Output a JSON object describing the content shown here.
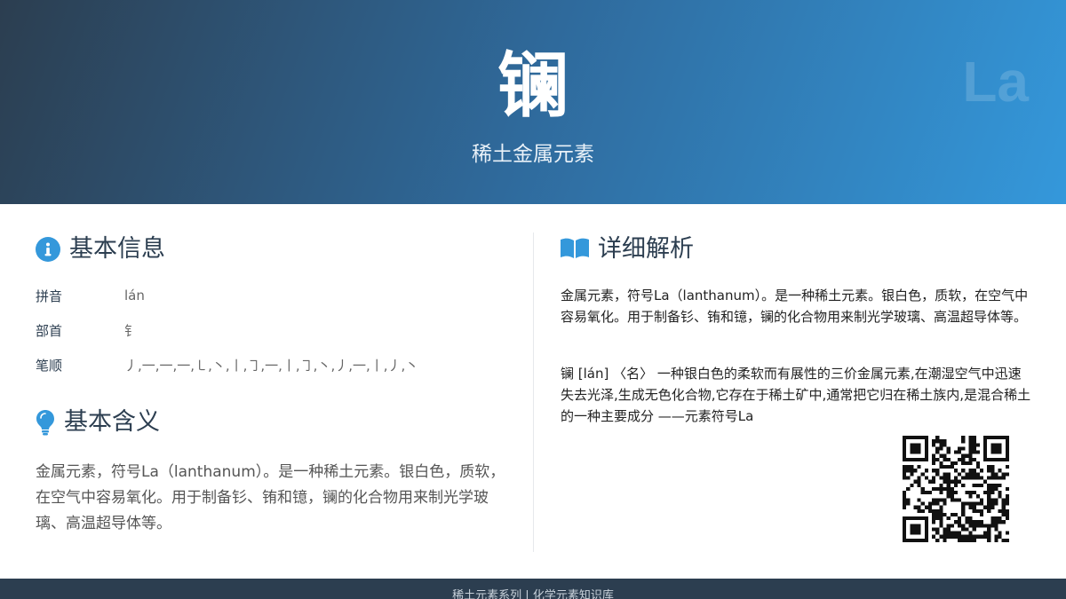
{
  "header": {
    "character": "镧",
    "subtitle": "稀土金属元素",
    "symbol": "La"
  },
  "basic_info": {
    "title": "基本信息",
    "icon": "info-circle-icon",
    "rows": [
      {
        "label": "拼音",
        "value": "lán"
      },
      {
        "label": "部首",
        "value": "钅"
      },
      {
        "label": "笔顺",
        "value": "丿,一,一,一,㇄,丶,丨,㇆,一,丨,㇆,丶,丿,一,丨,丿,丶"
      }
    ]
  },
  "basic_meaning": {
    "title": "基本含义",
    "icon": "lightbulb-icon",
    "text": "金属元素，符号La（lanthanum）。是一种稀土元素。银白色，质软，在空气中容易氧化。用于制备钐、铕和镱，镧的化合物用来制光学玻璃、高温超导体等。"
  },
  "detailed": {
    "title": "详细解析",
    "icon": "open-book-icon",
    "paragraph1": "金属元素，符号La（lanthanum）。是一种稀土元素。银白色，质软，在空气中容易氧化。用于制备钐、铕和镱，镧的化合物用来制光学玻璃、高温超导体等。",
    "paragraph2": "镧 [lán] 〈名〉 一种银白色的柔软而有展性的三价金属元素,在潮湿空气中迅速失去光泽,生成无色化合物,它存在于稀土矿中,通常把它归在稀土族内,是混合稀土的一种主要成分 ——元素符号La"
  },
  "footer": {
    "text": "稀土元素系列 | 化学元素知识库"
  },
  "colors": {
    "accent": "#3498db",
    "dark": "#2c3e50"
  }
}
